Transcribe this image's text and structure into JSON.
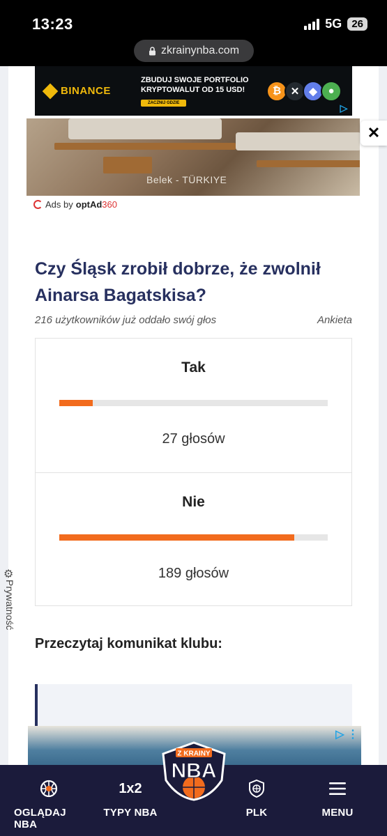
{
  "status": {
    "time": "13:23",
    "network": "5G",
    "battery": "26"
  },
  "browser": {
    "url": "zkrainynba.com"
  },
  "top_ad": {
    "brand": "BINANCE",
    "headline": "ZBUDUJ SWOJE PORTFOLIO KRYPTOWALUT OD 15 USD!",
    "cta": "ZACZNIJ GDZIE",
    "coins": [
      "₿",
      "✕",
      "◆",
      "●"
    ]
  },
  "hotel_ad": {
    "caption": "Belek - TÜRKIYE"
  },
  "ads_by": {
    "prefix": "Ads by",
    "brand": "optAd",
    "suffix": "360"
  },
  "poll": {
    "title": "Czy Śląsk zrobił dobrze, że zwolnił Ainarsa Bagatskisa?",
    "participants": "216 użytkowników już oddało swój głos",
    "type": "Ankieta",
    "options": [
      {
        "label": "Tak",
        "votes": "27 głosów",
        "fraction": 0.125
      },
      {
        "label": "Nie",
        "votes": "189 głosów",
        "fraction": 0.875
      }
    ],
    "bar_color": "#f26b1d"
  },
  "privacy": {
    "label": "Prywatność"
  },
  "article": {
    "read_heading": "Przeczytaj komunikat klubu:"
  },
  "nav": {
    "items": [
      {
        "label": "OGLĄDAJ NBA",
        "icon": "basketball-icon"
      },
      {
        "label": "TYPY NBA",
        "icon_text": "1x2"
      },
      {
        "label": "PLK",
        "icon": "shield-ball-icon"
      },
      {
        "label": "MENU",
        "icon": "hamburger-menu-icon"
      }
    ],
    "logo": {
      "line1": "Z KRAINY",
      "line2": "NBA"
    }
  }
}
